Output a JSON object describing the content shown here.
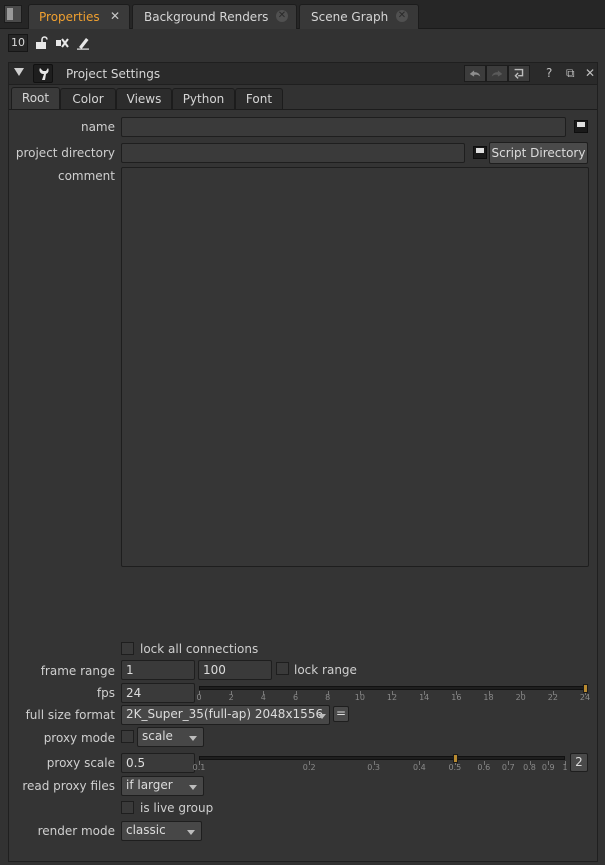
{
  "top_tabs": [
    {
      "label": "Properties"
    },
    {
      "label": "Background Renders"
    },
    {
      "label": "Scene Graph"
    }
  ],
  "toolbar": {
    "max_panels": "10"
  },
  "node": {
    "title": "Project Settings"
  },
  "sub_tabs": [
    {
      "label": "Root"
    },
    {
      "label": "Color"
    },
    {
      "label": "Views"
    },
    {
      "label": "Python"
    },
    {
      "label": "Font"
    }
  ],
  "form": {
    "name_label": "name",
    "name_value": "",
    "project_directory_label": "project directory",
    "project_directory_value": "",
    "script_directory_button": "Script Directory",
    "comment_label": "comment",
    "comment_value": "",
    "lock_all_connections_label": "lock all connections",
    "frame_range_label": "frame range",
    "frame_start": "1",
    "frame_end": "100",
    "lock_range_label": "lock range",
    "fps_label": "fps",
    "fps_value": "24",
    "fps_ticks": [
      "0",
      "2",
      "4",
      "6",
      "8",
      "10",
      "12",
      "14",
      "16",
      "18",
      "20",
      "22",
      "24"
    ],
    "full_size_format_label": "full size format",
    "full_size_format_value": "2K_Super_35(full-ap) 2048x1556",
    "format_equals_button": "=",
    "proxy_mode_label": "proxy mode",
    "proxy_mode_value": "scale",
    "proxy_scale_label": "proxy scale",
    "proxy_scale_value": "0.5",
    "proxy_scale_ticks": [
      "0.1",
      "0.2",
      "0.3",
      "0.4",
      "0.5",
      "0.6",
      "0.7",
      "0.8",
      "0.9",
      "1"
    ],
    "proxy_scale_step_button": "2",
    "read_proxy_files_label": "read proxy files",
    "read_proxy_files_value": "if larger",
    "is_live_group_label": "is live group",
    "render_mode_label": "render mode",
    "render_mode_value": "classic"
  },
  "colors": {
    "active_tab_text": "#f0a030",
    "background": "#323232",
    "slider_handle": "#b88a30"
  }
}
